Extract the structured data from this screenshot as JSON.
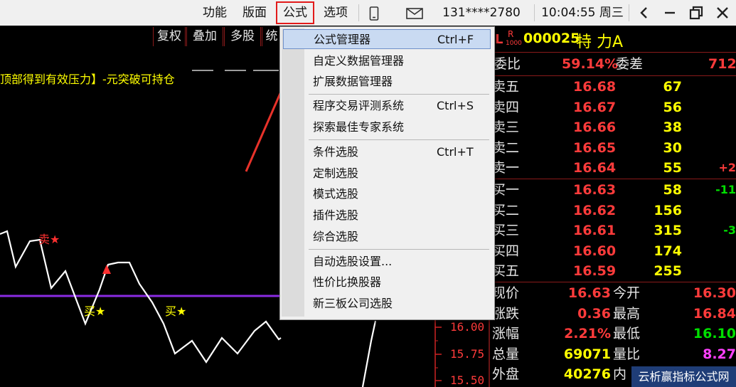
{
  "menubar": {
    "items": [
      "功能",
      "版面",
      "公式",
      "选项"
    ],
    "account": "131****2780",
    "clock": "10:04:55 周三"
  },
  "toolbar": {
    "buttons": [
      "复权",
      "叠加",
      "多股",
      "统"
    ]
  },
  "chart": {
    "annotation": "顶部得到有效压力】-元突破可持仓",
    "sell_marker": "卖★",
    "buy_marker_1": "买★",
    "buy_marker_2": "买★",
    "axis_labels": [
      "16.00",
      "15.75",
      "15.50"
    ],
    "colors": {
      "price_line": "#ffffff",
      "ref_line": "#8a2be2",
      "annotation": "#ffff00",
      "axis": "#ff3b3b"
    }
  },
  "menu": {
    "items": [
      {
        "label": "公式管理器",
        "shortcut": "Ctrl+F"
      },
      {
        "label": "自定义数据管理器",
        "shortcut": ""
      },
      {
        "label": "扩展数据管理器",
        "shortcut": ""
      },
      {
        "label": "程序交易评测系统",
        "shortcut": "Ctrl+S"
      },
      {
        "label": "探索最佳专家系统",
        "shortcut": ""
      },
      {
        "label": "条件选股",
        "shortcut": "Ctrl+T"
      },
      {
        "label": "定制选股",
        "shortcut": ""
      },
      {
        "label": "模式选股",
        "shortcut": ""
      },
      {
        "label": "插件选股",
        "shortcut": ""
      },
      {
        "label": "综合选股",
        "shortcut": ""
      },
      {
        "label": "自动选股设置...",
        "shortcut": ""
      },
      {
        "label": "性价比换股器",
        "shortcut": ""
      },
      {
        "label": "新三板公司选股",
        "shortcut": ""
      }
    ]
  },
  "quote": {
    "tag_l": "L",
    "tag_r": "R",
    "tag_num": "1000",
    "code": "000025",
    "name": "特 力A",
    "ratio_label": "委比",
    "ratio_value": "59.14%",
    "diff_label": "委差",
    "diff_value": "712",
    "asks": [
      {
        "label": "卖五",
        "price": "16.68",
        "vol": "67",
        "chg": ""
      },
      {
        "label": "卖四",
        "price": "16.67",
        "vol": "56",
        "chg": ""
      },
      {
        "label": "卖三",
        "price": "16.66",
        "vol": "38",
        "chg": ""
      },
      {
        "label": "卖二",
        "price": "16.65",
        "vol": "30",
        "chg": ""
      },
      {
        "label": "卖一",
        "price": "16.64",
        "vol": "55",
        "chg": "+2"
      }
    ],
    "bids": [
      {
        "label": "买一",
        "price": "16.63",
        "vol": "58",
        "chg": "-11"
      },
      {
        "label": "买二",
        "price": "16.62",
        "vol": "156",
        "chg": ""
      },
      {
        "label": "买三",
        "price": "16.61",
        "vol": "315",
        "chg": "-3"
      },
      {
        "label": "买四",
        "price": "16.60",
        "vol": "174",
        "chg": ""
      },
      {
        "label": "买五",
        "price": "16.59",
        "vol": "255",
        "chg": ""
      }
    ],
    "stats": [
      {
        "l1": "现价",
        "v1": "16.63",
        "c1": "#ff3b3b",
        "l2": "今开",
        "v2": "16.30",
        "c2": "#ff3b3b"
      },
      {
        "l1": "涨跌",
        "v1": "0.36",
        "c1": "#ff3b3b",
        "l2": "最高",
        "v2": "16.84",
        "c2": "#ff3b3b"
      },
      {
        "l1": "涨幅",
        "v1": "2.21%",
        "c1": "#ff3b3b",
        "l2": "最低",
        "v2": "16.10",
        "c2": "#00e000"
      },
      {
        "l1": "总量",
        "v1": "69071",
        "c1": "#ffff00",
        "l2": "量比",
        "v2": "8.27",
        "c2": "#ff40ff"
      },
      {
        "l1": "外盘",
        "v1": "40276",
        "c1": "#ffff00",
        "l2": "内",
        "v2": "",
        "c2": "#00e000"
      }
    ]
  },
  "watermark": "云析赢指标公式网"
}
